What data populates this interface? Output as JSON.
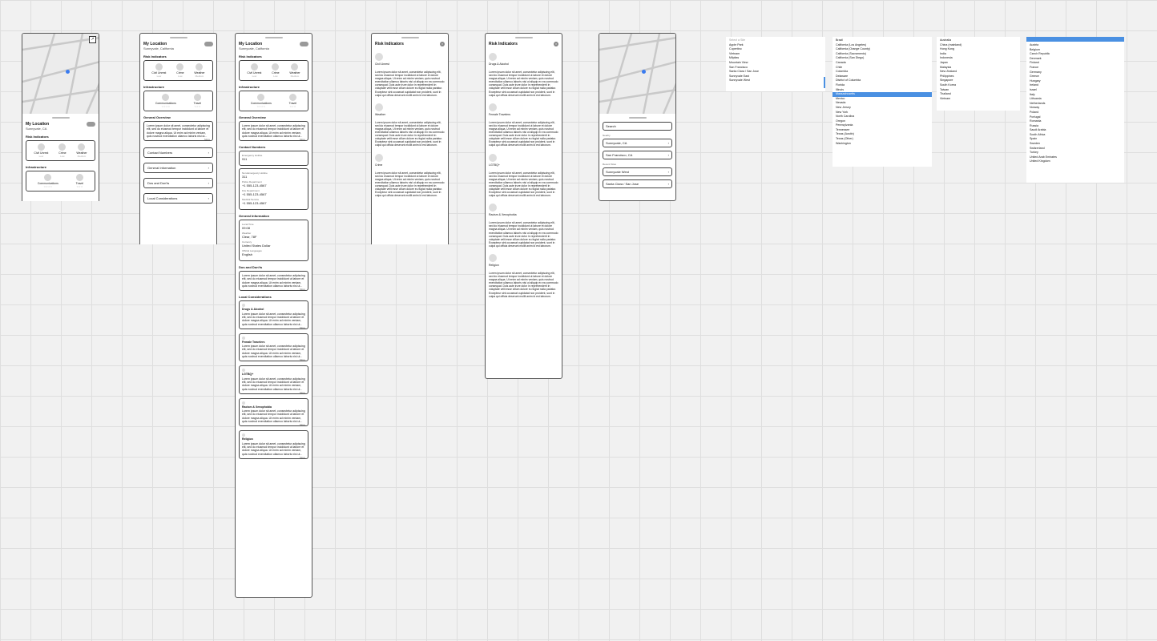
{
  "common": {
    "my_location": "My Location",
    "location_short": "Sunnyvale, CA",
    "location_full": "Sunnyvale, California",
    "risk_indicators": "Risk Indicators",
    "infrastructure": "Infrastructure",
    "general_overview": "General Overview",
    "lorem_short": "Lorem ipsum dolor sit amet, consectetur adipiscing elit, sed do eiusmod tempor incididunt ut labore et dolore magna aliqua. Ut enim ad minim veniam, quis nostrud exercitation ullamco laboris nisi ut...",
    "lorem_long": "Lorem ipsum dolor sit amet, consectetur adipiscing elit, sed do eiusmod tempor incididunt ut labore et dolore magna aliqua. Ut enim ad minim veniam, quis nostrud exercitation ullamco laboris nisi ut aliquip ex ea commodo consequat. Duis aute irure dolor in reprehenderit in voluptate velit esse cillum dolore eu fugiat nulla pariatur. Excepteur sint occaecat cupidatat non proident, sunt in culpa qui officia deserunt mollit anim id est laborum.",
    "more": "More",
    "indicators": [
      {
        "label": "Civil Unrest",
        "level": "Low"
      },
      {
        "label": "Crime",
        "level": "Low"
      },
      {
        "label": "Weather",
        "level": "Medium"
      }
    ],
    "infra": [
      {
        "label": "Communications",
        "stars": "☆☆☆☆"
      },
      {
        "label": "Travel",
        "stars": "☆☆☆"
      }
    ]
  },
  "screen2": {
    "nav": [
      "Contact Numbers",
      "General Information",
      "Dos and Don'ts",
      "Local Considerations"
    ]
  },
  "screen3": {
    "contacts_title": "Contact Numbers",
    "contacts": [
      {
        "label": "Emergency Hotline",
        "value": "911"
      },
      {
        "label": "Non-Emergency Hotline",
        "value": "311"
      },
      {
        "label": "Police Department",
        "value": "+1 555-123-4567"
      },
      {
        "label": "Fire Department",
        "value": "+1 555-123-4567"
      },
      {
        "label": "Medical Service",
        "value": "+1 555-123-4567"
      }
    ],
    "geninfo_title": "General Information",
    "geninfo": [
      {
        "label": "Local Time",
        "value": "09:08"
      },
      {
        "label": "Weather",
        "value": "Clear, 78F"
      },
      {
        "label": "Currency",
        "value": "United States Dollar"
      },
      {
        "label": "Official Languages",
        "value": "English"
      }
    ],
    "dos_title": "Dos and Don'ts",
    "local_title": "Local Considerations",
    "local": [
      "Drugs & Alcohol",
      "Female Travelers",
      "LGTBQ+",
      "Racism & Xenophobia",
      "Religion"
    ]
  },
  "risk1": {
    "title": "Risk Indicators",
    "items": [
      "Civil Unrest",
      "Weather",
      "Crime"
    ]
  },
  "risk2": {
    "title": "Risk Indicators",
    "items": [
      "Drugs & Alcohol",
      "Female Travelers",
      "LGTBQ+",
      "Racism & Xenophobia",
      "Religion"
    ]
  },
  "search": {
    "placeholder": "Search",
    "nearby_label": "Nearby",
    "nearby": [
      "Sunnyvale, CA",
      "San Francisco, CA"
    ],
    "recent_label": "Recent Sites",
    "recent": [
      "Sunnyvale West",
      "Santa Clara / San Jose"
    ]
  },
  "lists": {
    "list1_header": "Select a Site",
    "list1": [
      "Apple Park",
      "Cupertino",
      "Vietnam",
      "Milpitas",
      "Mountain View",
      "San Francisco",
      "Santa Clara / San Jose",
      "Sunnyvale East",
      "Sunnyvale West"
    ],
    "list2": [
      "Brazil",
      "California (Los Angeles)",
      "California (Orange County)",
      "California (Sacramento)",
      "California (San Diego)",
      "Canada",
      "Chile",
      "Colombia",
      "Delaware",
      "District of Columbia",
      "Florida",
      "Illinois",
      "Massachusetts",
      "Mexico",
      "Nevada",
      "New Jersey",
      "New York",
      "North Carolina",
      "Oregon",
      "Pennsylvania",
      "Tennessee",
      "Texas (Austin)",
      "Texas (Other)",
      "Washington"
    ],
    "list3": [
      "Australia",
      "China (mainland)",
      "Hong Kong",
      "India",
      "Indonesia",
      "Japan",
      "Malaysia",
      "New Zealand",
      "Philippines",
      "Singapore",
      "South Korea",
      "Taiwan",
      "Thailand",
      "Vietnam"
    ],
    "list4": [
      "Austria",
      "Belgium",
      "Czech Republic",
      "Denmark",
      "Finland",
      "France",
      "Germany",
      "Greece",
      "Hungary",
      "Ireland",
      "Israel",
      "Italy",
      "Lithuania",
      "Netherlands",
      "Norway",
      "Poland",
      "Portugal",
      "Romania",
      "Russia",
      "Saudi Arabia",
      "South Africa",
      "Spain",
      "Sweden",
      "Switzerland",
      "Turkey",
      "United Arab Emirates",
      "United Kingdom"
    ]
  },
  "colors": {
    "accent": "#4a90e2",
    "pin": "#3a7bf0"
  }
}
